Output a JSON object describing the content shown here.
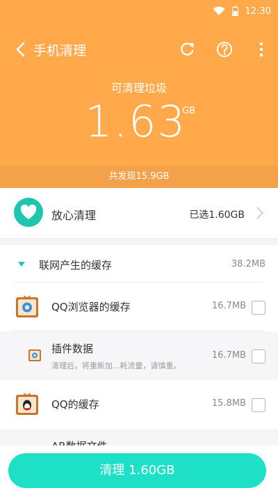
{
  "status": {
    "time": "12:30"
  },
  "header": {
    "title": "手机清理",
    "subtitle": "可清理垃圾",
    "amount": "1.63",
    "unit": "GB",
    "found": "共发现15.9GB",
    "colors": {
      "primary": "#ffa94b",
      "accent": "#1ec6b0"
    }
  },
  "summary": {
    "label": "放心清理",
    "value": "已选1.60GB"
  },
  "group": {
    "title": "联网产生的缓存",
    "size": "38.2MB"
  },
  "items": [
    {
      "title": "QQ浏览器的缓存",
      "size": "16.7MB"
    },
    {
      "title": "插件数据",
      "desc": "清理后，将重新加...耗流量，请慎重。",
      "size": "16.7MB"
    },
    {
      "title": "QQ的缓存",
      "size": "15.8MB"
    },
    {
      "title": "AR数据文件"
    }
  ],
  "button": {
    "label": "清理 1.60GB"
  }
}
